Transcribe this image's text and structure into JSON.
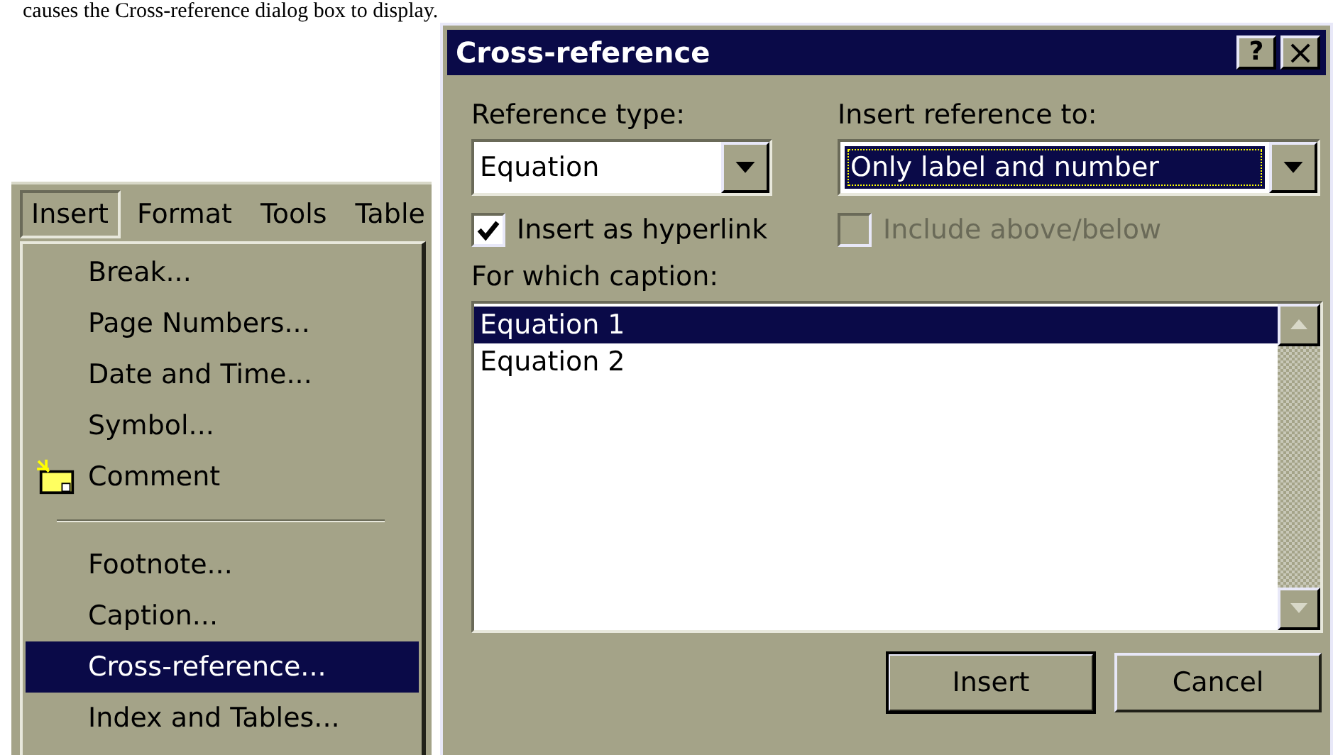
{
  "caption_text": "causes the Cross-reference dialog box to display.",
  "menu_bar": [
    {
      "label": "Insert",
      "selected": true
    },
    {
      "label": "Format",
      "selected": false
    },
    {
      "label": "Tools",
      "selected": false
    },
    {
      "label": "Table",
      "selected": false
    }
  ],
  "menu": [
    {
      "kind": "item",
      "label": "Break...",
      "selected": false
    },
    {
      "kind": "item",
      "label": "Page Numbers...",
      "selected": false
    },
    {
      "kind": "item",
      "label": "Date and Time...",
      "selected": false
    },
    {
      "kind": "item",
      "label": "Symbol...",
      "selected": false
    },
    {
      "kind": "icon_item",
      "label": "Comment",
      "selected": false
    },
    {
      "kind": "separator"
    },
    {
      "kind": "item",
      "label": "Footnote...",
      "selected": false
    },
    {
      "kind": "item",
      "label": "Caption...",
      "selected": false
    },
    {
      "kind": "item",
      "label": "Cross-reference...",
      "selected": true
    },
    {
      "kind": "item",
      "label": "Index and Tables...",
      "selected": false
    }
  ],
  "dialog": {
    "title": "Cross-reference",
    "title_buttons": [
      {
        "kind": "help",
        "label": "?"
      },
      {
        "kind": "close",
        "label": "×"
      }
    ],
    "reference_type": {
      "label": "Reference type:",
      "value": "Equation",
      "focused": false
    },
    "insert_reference_to": {
      "label": "Insert reference to:",
      "value": "Only label and number",
      "focused": true
    },
    "checkboxes": [
      {
        "label": "Insert as hyperlink",
        "checked": true,
        "disabled": false
      },
      {
        "label": "Include above/below",
        "checked": false,
        "disabled": true
      }
    ],
    "caption_list": {
      "label": "For which caption:",
      "items": [
        {
          "label": "Equation 1",
          "selected": true
        },
        {
          "label": "Equation 2",
          "selected": false
        }
      ]
    },
    "buttons": [
      {
        "label": "Insert",
        "default": true
      },
      {
        "label": "Cancel",
        "default": false
      }
    ]
  }
}
